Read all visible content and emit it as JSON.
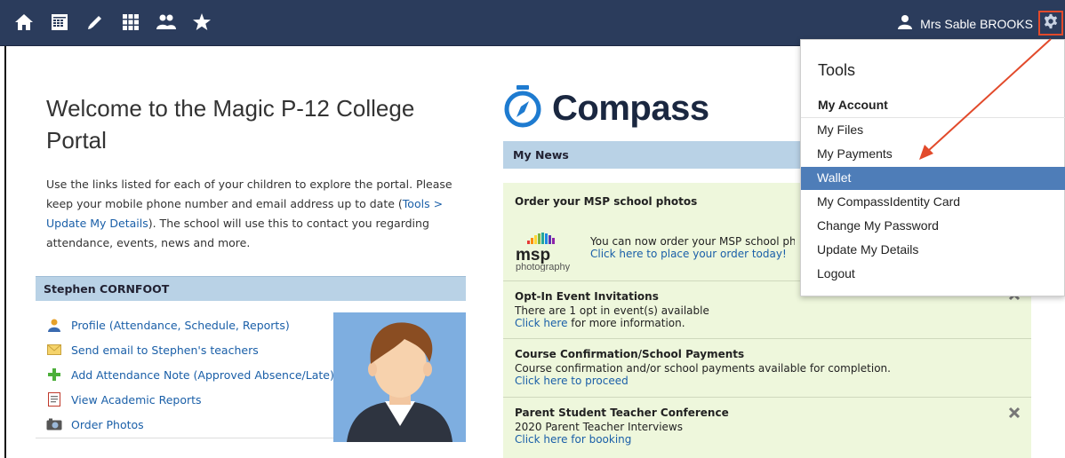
{
  "topbar": {
    "nav_icons": [
      "home-icon",
      "calendar-icon",
      "pencil-icon",
      "grid-icon",
      "people-icon",
      "star-icon"
    ],
    "user_name": "Mrs Sable BROOKS",
    "settings_icon": "gear-icon"
  },
  "welcome": {
    "title": "Welcome to the Magic P-12 College Portal",
    "intro_before": "Use the links listed for each of your children to explore the portal. Please keep your mobile phone number and email address up to date (",
    "intro_link": "Tools > Update My Details",
    "intro_after": "). The school will use this to contact you regarding attendance, events, news and more."
  },
  "child": {
    "name": "Stephen CORNFOOT",
    "links": [
      {
        "label": "Profile (Attendance, Schedule, Reports)",
        "icon": "person-icon"
      },
      {
        "label": "Send email to Stephen's teachers",
        "icon": "envelope-icon"
      },
      {
        "label": "Add Attendance Note (Approved Absence/Late)",
        "icon": "plus-icon"
      },
      {
        "label": "View Academic Reports",
        "icon": "report-icon"
      },
      {
        "label": "Order Photos",
        "icon": "camera-icon"
      }
    ]
  },
  "logo": {
    "text": "Compass"
  },
  "news": {
    "header": "My News",
    "items": [
      {
        "title": "Order your MSP school photos",
        "logo_text": "msp",
        "logo_sub": "photography",
        "body": "You can now order your MSP school photos",
        "link": "Click here to place your order today!"
      },
      {
        "title": "Opt-In Event Invitations",
        "body": "There are 1 opt in event(s) available",
        "link": "Click here",
        "link_after": " for more information."
      },
      {
        "title": "Course Confirmation/School Payments",
        "body": "Course confirmation and/or school payments available for completion.",
        "link": "Click here to proceed"
      },
      {
        "title": "Parent Student Teacher Conference",
        "body": "2020 Parent Teacher Interviews",
        "link": "Click here for booking"
      }
    ]
  },
  "tools": {
    "title": "Tools",
    "section": "My Account",
    "items": [
      {
        "label": "My Files"
      },
      {
        "label": "My Payments"
      },
      {
        "label": "Wallet",
        "active": true
      },
      {
        "label": "My CompassIdentity Card"
      },
      {
        "label": "Change My Password"
      },
      {
        "label": "Update My Details"
      },
      {
        "label": "Logout"
      }
    ]
  },
  "colors": {
    "topbar": "#2b3c5c",
    "header_blue": "#b9d2e6",
    "news_bg": "#eef7dc",
    "link": "#1a5fa8",
    "active_item": "#4e7db8",
    "annotation_arrow": "#e24a2b"
  }
}
